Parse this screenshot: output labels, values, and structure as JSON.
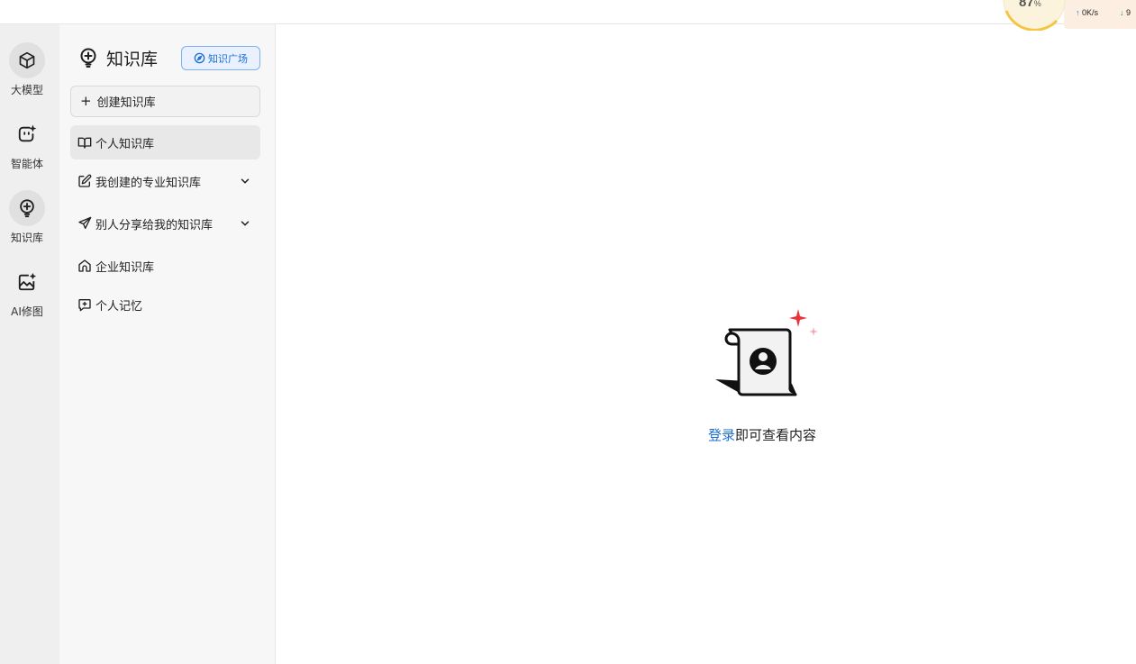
{
  "status_widget": {
    "percent": "87",
    "percent_sign": "%",
    "upload_speed": "0K/s",
    "download_speed": "9",
    "up_arrow": "↑",
    "down_arrow": "↓"
  },
  "rail": {
    "items": [
      {
        "label": "大模型",
        "icon": "cube-icon"
      },
      {
        "label": "智能体",
        "icon": "agent-icon"
      },
      {
        "label": "知识库",
        "icon": "bulb-icon",
        "active": true
      },
      {
        "label": "AI修图",
        "icon": "image-edit-icon"
      }
    ]
  },
  "panel": {
    "title": "知识库",
    "plaza_label": "知识广场",
    "create_label": "创建知识库",
    "create_plus": "+",
    "items": [
      {
        "label": "个人知识库",
        "icon": "book-icon",
        "active": true
      },
      {
        "label": "我创建的专业知识库",
        "icon": "edit-icon",
        "expandable": true
      },
      {
        "label": "别人分享给我的知识库",
        "icon": "send-icon",
        "expandable": true
      },
      {
        "label": "企业知识库",
        "icon": "home-icon"
      },
      {
        "label": "个人记忆",
        "icon": "memory-icon"
      }
    ]
  },
  "main": {
    "login_link": "登录",
    "empty_text": "即可查看内容"
  },
  "colors": {
    "accent": "#1d6fd6",
    "sparkle": "#e8323c",
    "gauge": "#f5c542"
  }
}
